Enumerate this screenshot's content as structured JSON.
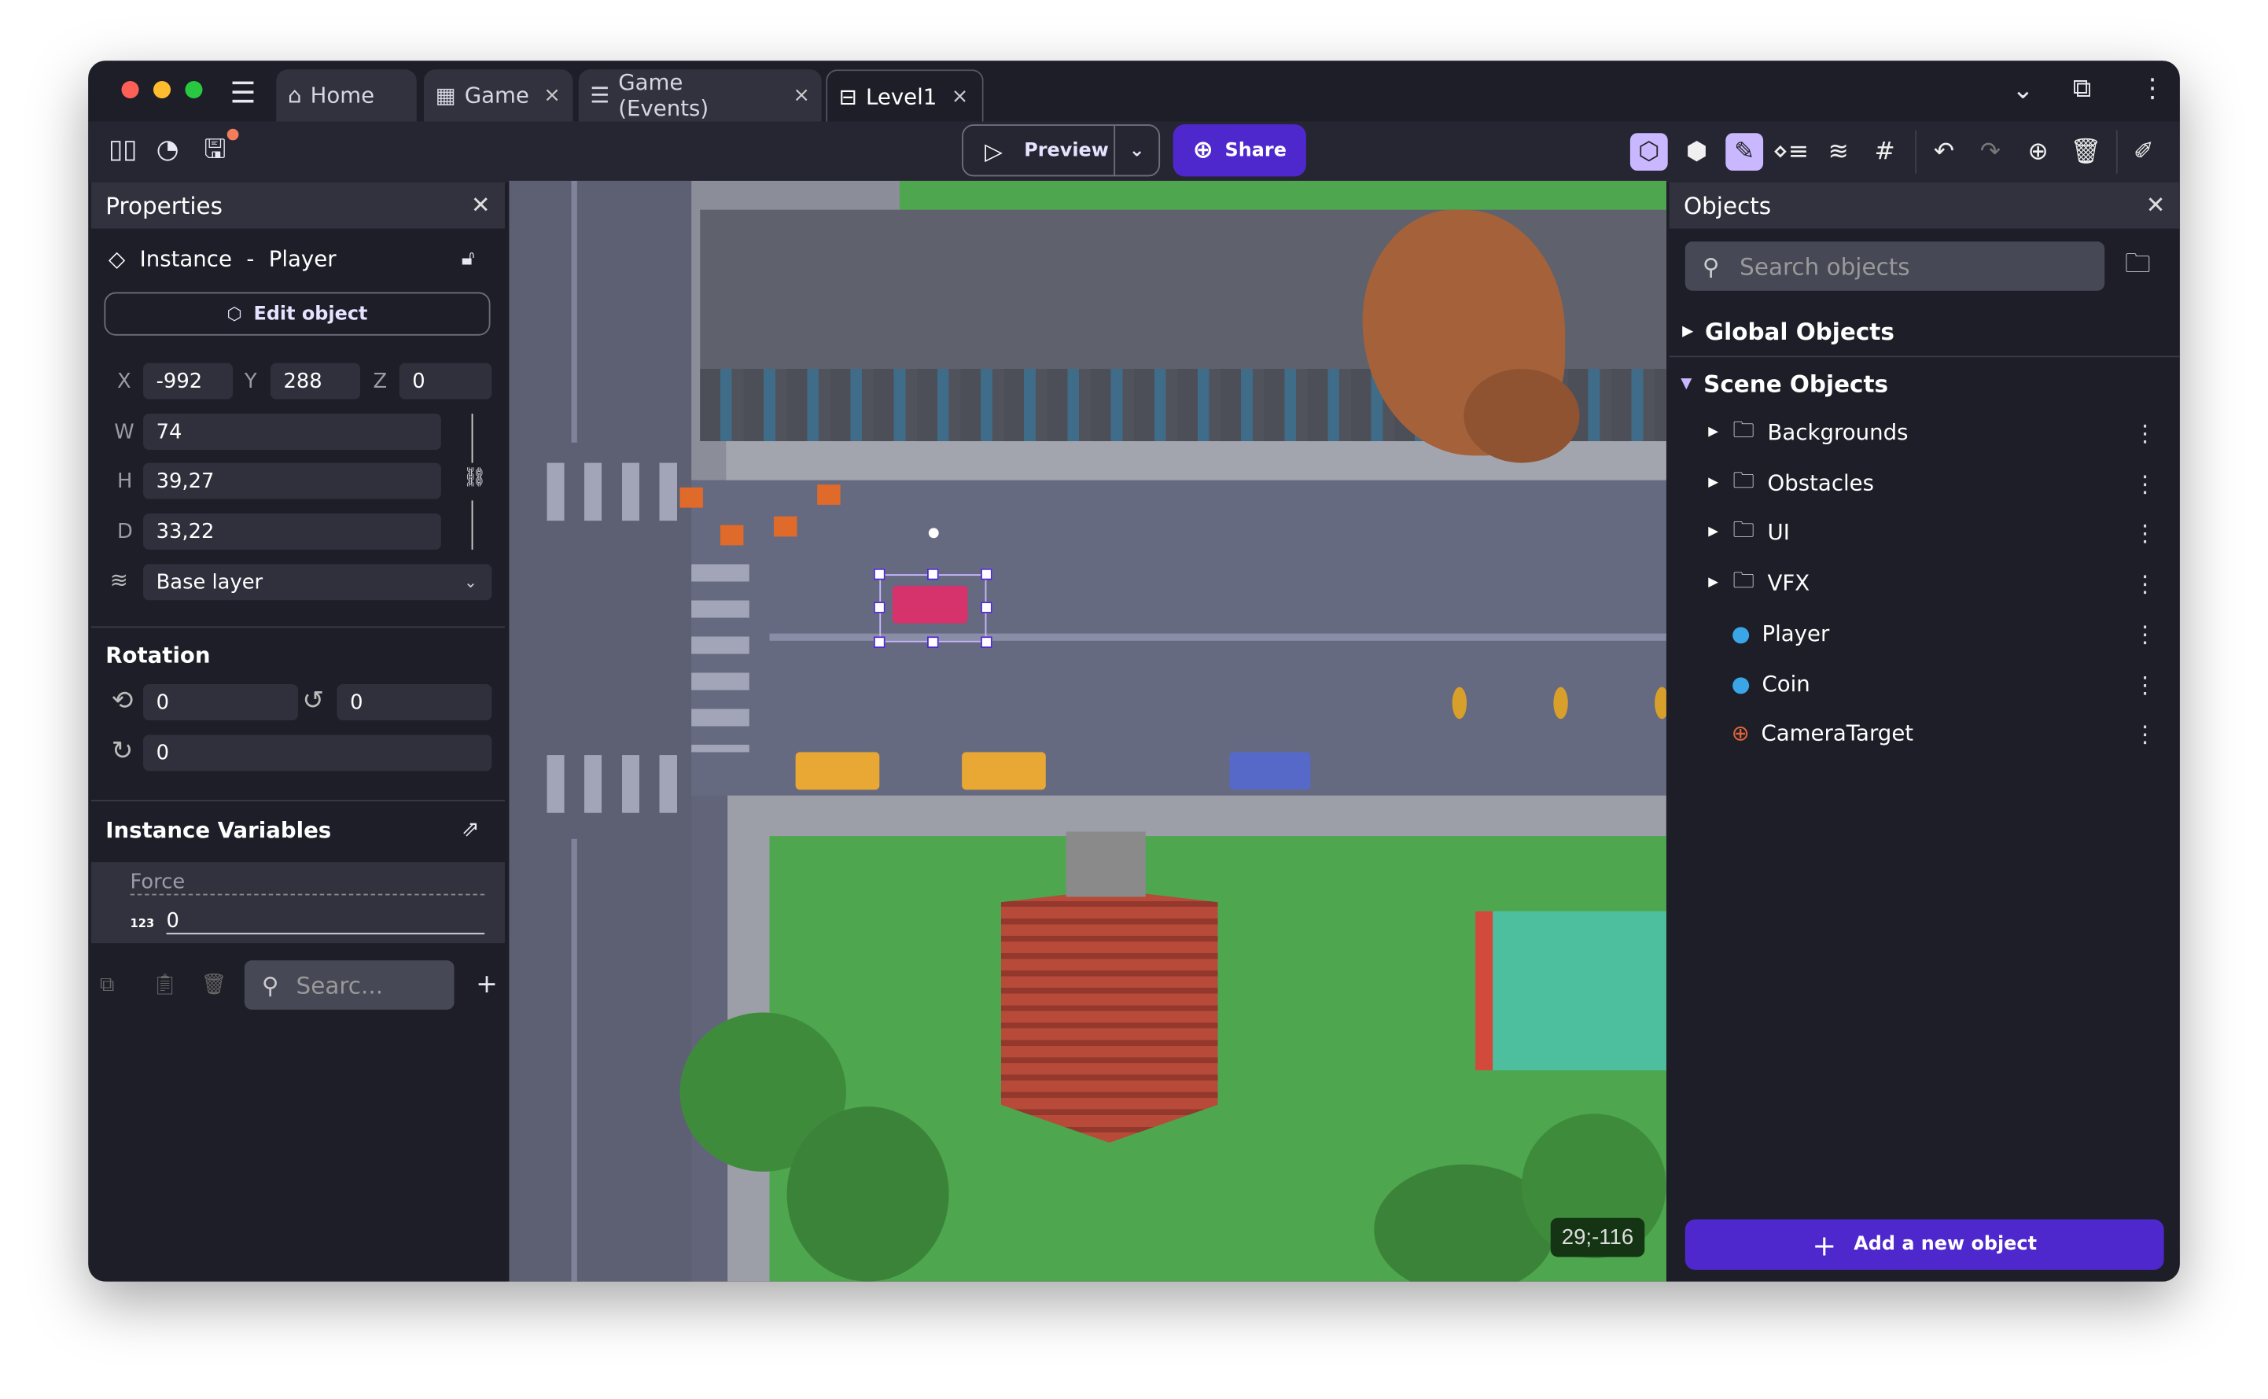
{
  "window": {
    "tabs": [
      {
        "label": "Home",
        "icon": "home-icon",
        "closable": false
      },
      {
        "label": "Game",
        "icon": "film-icon",
        "closable": true
      },
      {
        "label": "Game (Events)",
        "icon": "events-icon",
        "closable": true
      },
      {
        "label": "Level1",
        "icon": "scene-icon",
        "closable": true,
        "active": true
      }
    ],
    "close_glyph": "×"
  },
  "toolbar": {
    "preview_label": "Preview",
    "share_label": "Share",
    "accent": "#4f28cd"
  },
  "properties": {
    "title": "Properties",
    "instance_label": "Instance",
    "separator": "-",
    "object_name": "Player",
    "edit_object_label": "Edit object",
    "x_label": "X",
    "x": "-992",
    "y_label": "Y",
    "y": "288",
    "z_label": "Z",
    "z": "0",
    "w_label": "W",
    "w": "74",
    "h_label": "H",
    "h": "39,27",
    "d_label": "D",
    "d": "33,22",
    "layer": "Base layer",
    "rotation_title": "Rotation",
    "rot_x": "0",
    "rot_y": "0",
    "rot_z": "0",
    "variables_title": "Instance Variables",
    "variable_name": "Force",
    "variable_type": "123",
    "variable_value": "0",
    "search_placeholder": "Searc..."
  },
  "canvas": {
    "cursor_coords": "29;-116"
  },
  "objects": {
    "title": "Objects",
    "search_placeholder": "Search objects",
    "global_label": "Global Objects",
    "scene_label": "Scene Objects",
    "folders": [
      {
        "label": "Backgrounds"
      },
      {
        "label": "Obstacles"
      },
      {
        "label": "UI"
      },
      {
        "label": "VFX"
      }
    ],
    "items": [
      {
        "label": "Player",
        "icon": "3d-model-icon"
      },
      {
        "label": "Coin",
        "icon": "3d-model-icon"
      },
      {
        "label": "CameraTarget",
        "icon": "crosshair-icon"
      }
    ],
    "add_label": "Add a new object"
  }
}
